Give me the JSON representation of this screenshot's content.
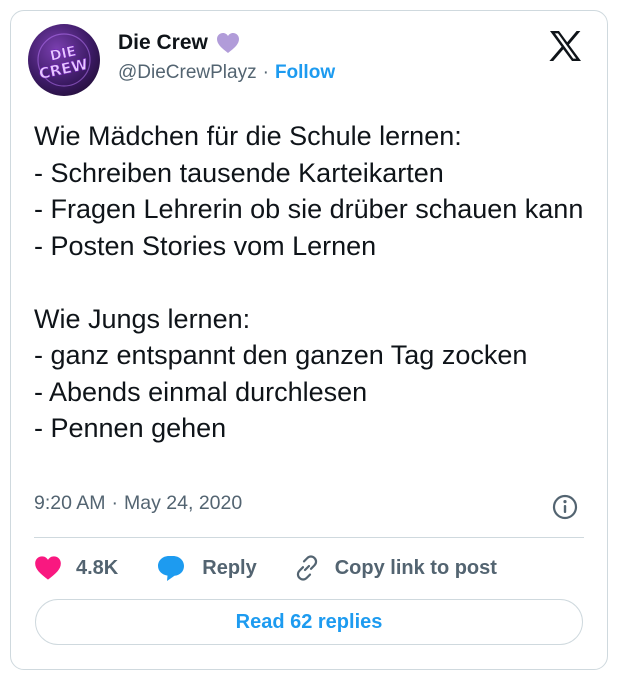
{
  "author": {
    "name": "Die Crew",
    "handle": "@DieCrewPlayz",
    "separator": "·",
    "follow_label": "Follow",
    "avatar_text": "DIE CREW",
    "badge_color": "#b19cd9"
  },
  "tweet": {
    "text": "Wie Mädchen für die Schule lernen:\n- Schreiben tausende Karteikarten\n- Fragen Lehrerin ob sie drüber schauen kann\n- Posten Stories vom Lernen\n\nWie Jungs lernen:\n- ganz entspannt den ganzen Tag zocken\n- Abends einmal durchlesen\n- Pennen gehen",
    "time": "9:20 AM",
    "separator": "·",
    "date": "May 24, 2020"
  },
  "actions": {
    "like_count": "4.8K",
    "reply_label": "Reply",
    "copy_label": "Copy link to post",
    "read_replies_label": "Read 62 replies"
  },
  "icons": {
    "platform": "x-logo-icon",
    "badge": "purple-heart-icon",
    "like": "heart-icon",
    "reply": "speech-bubble-icon",
    "copy": "link-icon",
    "info": "info-icon"
  },
  "colors": {
    "accent": "#1d9bf0",
    "like": "#f91880",
    "text": "#0f1419",
    "secondary": "#536471",
    "border": "#cfd9de"
  }
}
